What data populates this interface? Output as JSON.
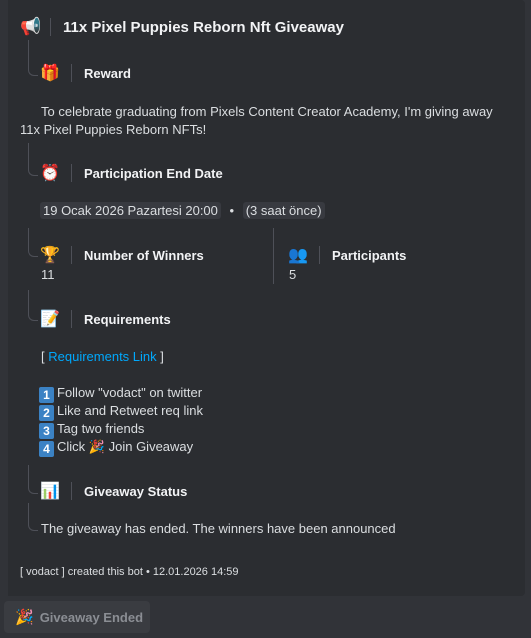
{
  "embed": {
    "title": "11x Pixel Puppies Reborn Nft Giveaway",
    "title_icon": "megaphone-icon",
    "reward": {
      "label": "Reward",
      "icon": "gift-icon",
      "text_line1": "To celebrate graduating from Pixels Content Creator Academy, I'm giving away",
      "text_line2": "11x Pixel Puppies Reborn NFTs!"
    },
    "end_date": {
      "label": "Participation End Date",
      "icon": "alarm-clock-icon",
      "date": "19 Ocak 2026 Pazartesi 20:00",
      "separator": "•",
      "relative": "(3 saat önce)"
    },
    "winners": {
      "label": "Number of Winners",
      "icon": "trophy-icon",
      "value": "11"
    },
    "participants": {
      "label": "Participants",
      "icon": "busts-icon",
      "value": "5"
    },
    "requirements": {
      "label": "Requirements",
      "icon": "memo-icon",
      "link_open": "[",
      "link_text": "Requirements Link",
      "link_close": "]",
      "items": [
        {
          "num": "1",
          "text": "Follow \"vodact\" on twitter"
        },
        {
          "num": "2",
          "text": "Like and Retweet req link"
        },
        {
          "num": "3",
          "text": "Tag two friends"
        },
        {
          "num": "4",
          "text_before": "Click",
          "text_after": "Join Giveaway"
        }
      ]
    },
    "status": {
      "label": "Giveaway Status",
      "icon": "bar-chart-icon",
      "text": "The giveaway has ended. The winners have been announced"
    },
    "footer": "[ vodact ] created this bot • 12.01.2026 14:59"
  },
  "button": {
    "label": "Giveaway Ended",
    "icon": "party-popper-icon"
  },
  "colors": {
    "background": "#313338",
    "embed": "#2b2d31",
    "link": "#00a8fc",
    "number_badge": "#3b82c4"
  }
}
